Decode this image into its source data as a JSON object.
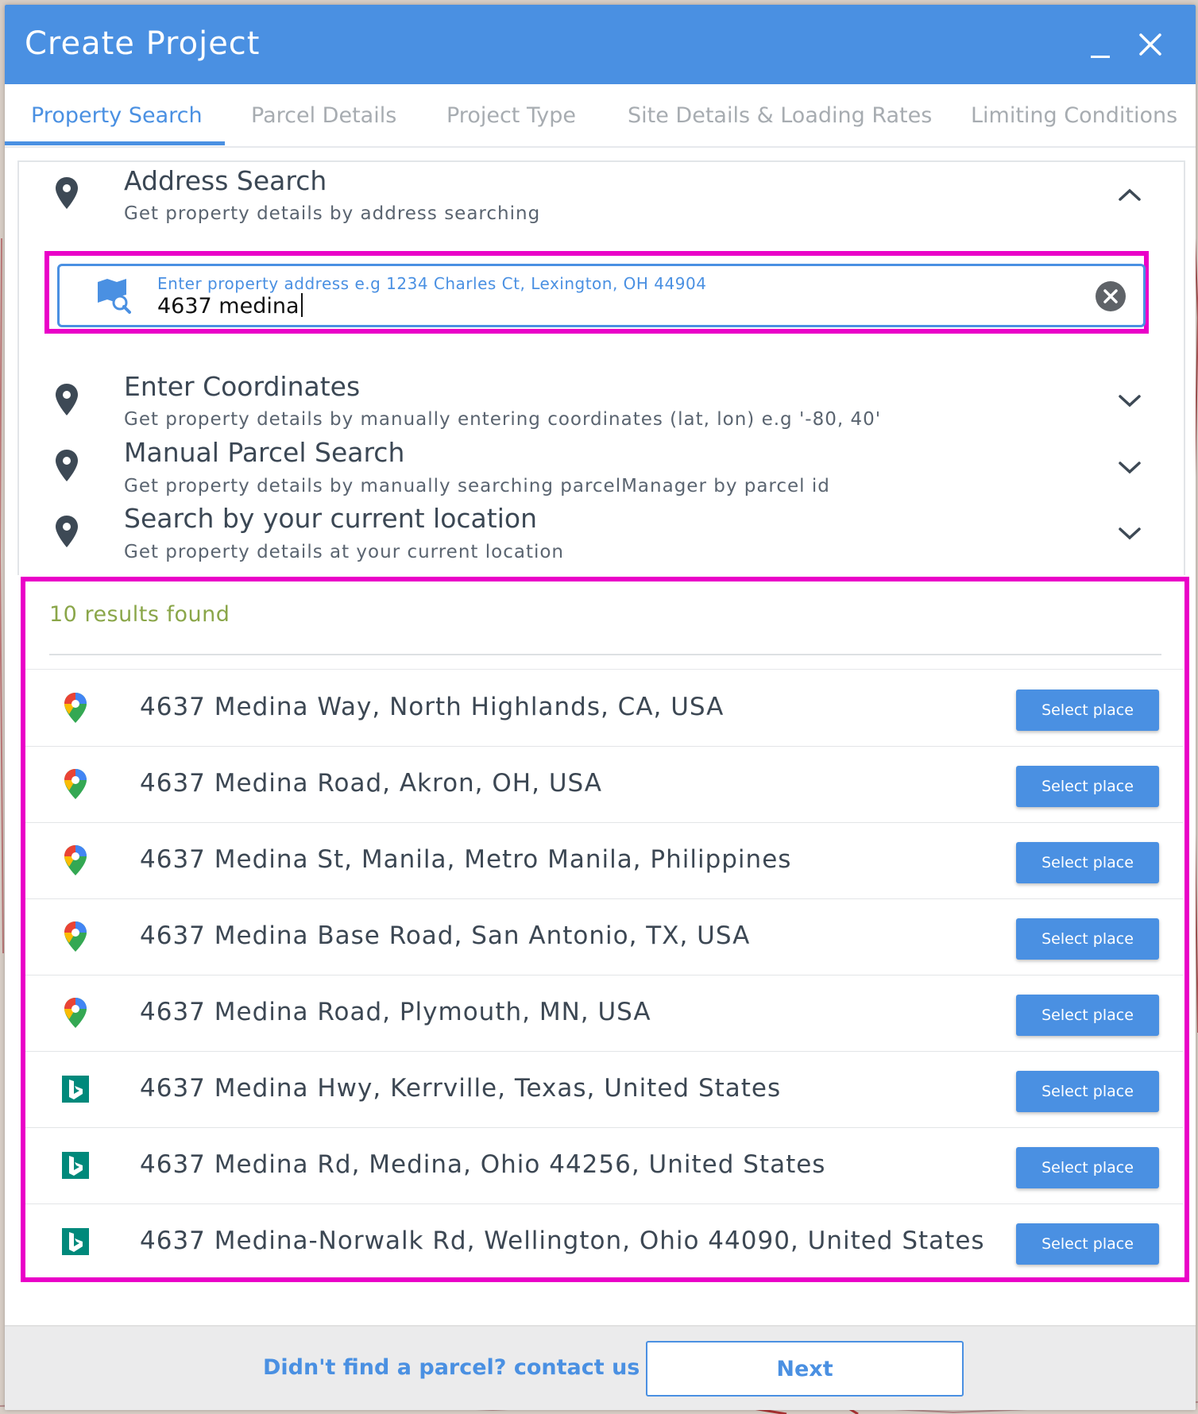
{
  "dialog": {
    "title": "Create Project",
    "minimize_icon": "minimize-icon",
    "close_icon": "close-icon"
  },
  "tabs": [
    {
      "label": "Property Search",
      "active": true
    },
    {
      "label": "Parcel Details",
      "active": false
    },
    {
      "label": "Project Type",
      "active": false
    },
    {
      "label": "Site Details & Loading Rates",
      "active": false
    },
    {
      "label": "Limiting Conditions",
      "active": false
    }
  ],
  "search_options": [
    {
      "title": "Address Search",
      "subtitle": "Get property details by address searching",
      "expanded": true,
      "icon": "location-pin-icon"
    },
    {
      "title": "Enter Coordinates",
      "subtitle": "Get property details by manually entering coordinates (lat, lon) e.g '-80, 40'",
      "expanded": false,
      "icon": "location-pin-icon"
    },
    {
      "title": "Manual Parcel Search",
      "subtitle": "Get property details by manually searching parcelManager by parcel id",
      "expanded": false,
      "icon": "location-pin-icon"
    },
    {
      "title": "Search by your current location",
      "subtitle": "Get property details at your current location",
      "expanded": false,
      "icon": "location-pin-icon"
    }
  ],
  "address_input": {
    "placeholder": "Enter property address e.g 1234 Charles Ct, Lexington, OH 44904",
    "value": "4637 medina",
    "icon": "map-search-icon",
    "clear_icon": "clear-circle-icon"
  },
  "results": {
    "count_label": "10 results found",
    "select_label": "Select place",
    "items": [
      {
        "address": "4637 Medina Way, North Highlands, CA, USA",
        "source": "google-maps-pin-icon"
      },
      {
        "address": "4637 Medina Road, Akron, OH, USA",
        "source": "google-maps-pin-icon"
      },
      {
        "address": "4637 Medina St, Manila, Metro Manila, Philippines",
        "source": "google-maps-pin-icon"
      },
      {
        "address": "4637 Medina Base Road, San Antonio, TX, USA",
        "source": "google-maps-pin-icon"
      },
      {
        "address": "4637 Medina Road, Plymouth, MN, USA",
        "source": "google-maps-pin-icon"
      },
      {
        "address": "4637 Medina Hwy, Kerrville, Texas, United States",
        "source": "bing-logo-icon"
      },
      {
        "address": "4637 Medina Rd, Medina, Ohio 44256, United States",
        "source": "bing-logo-icon"
      },
      {
        "address": "4637 Medina-Norwalk Rd, Wellington, Ohio 44090, United States",
        "source": "bing-logo-icon"
      }
    ]
  },
  "footer": {
    "contact_link": "Didn't find a parcel? contact us",
    "next_label": "Next"
  },
  "colors": {
    "primary": "#4a90e2",
    "highlight": "#ea00c8",
    "results_count": "#8aa649"
  }
}
